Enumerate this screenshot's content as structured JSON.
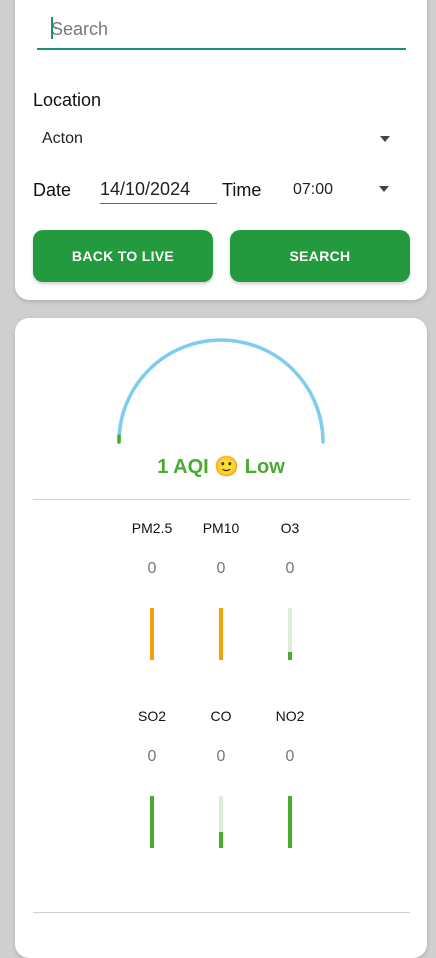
{
  "search": {
    "placeholder": "Search"
  },
  "location": {
    "label": "Location",
    "value": "Acton"
  },
  "datetime": {
    "date_label": "Date",
    "date_value": "14/10/2024",
    "time_label": "Time",
    "time_value": "07:00"
  },
  "buttons": {
    "back_to_live": "BACK TO LIVE",
    "search": "SEARCH"
  },
  "aqi": {
    "value": "1 AQI",
    "emoji": "🙂",
    "level": "Low",
    "color": "#4aab32",
    "gauge_color": "#7ecdf0"
  },
  "pollutants": [
    {
      "name": "PM2.5",
      "value": "0",
      "level": 1.0,
      "color": "#f5a20a"
    },
    {
      "name": "PM10",
      "value": "0",
      "level": 1.0,
      "color": "#f5a20a"
    },
    {
      "name": "O3",
      "value": "0",
      "level": 0.15,
      "color": "#4aab32"
    },
    {
      "name": "SO2",
      "value": "0",
      "level": 1.0,
      "color": "#4aab32"
    },
    {
      "name": "CO",
      "value": "0",
      "level": 0.3,
      "color": "#4aab32"
    },
    {
      "name": "NO2",
      "value": "0",
      "level": 1.0,
      "color": "#4aab32"
    }
  ]
}
